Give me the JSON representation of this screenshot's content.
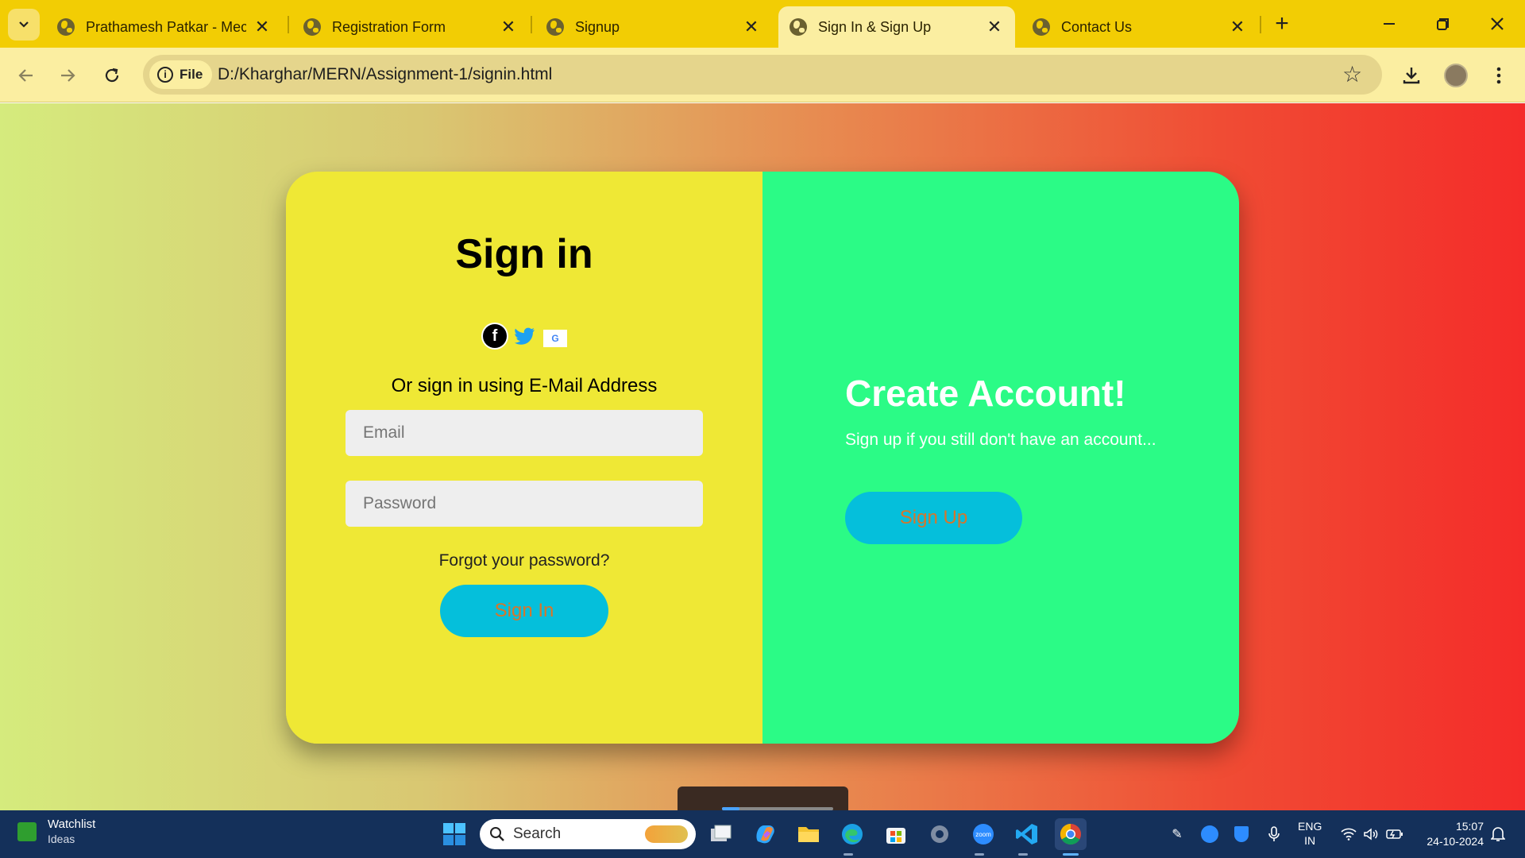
{
  "browser": {
    "tabs": [
      {
        "title": "Prathamesh Patkar - Mecha",
        "active": false
      },
      {
        "title": "Registration Form",
        "active": false
      },
      {
        "title": "Signup",
        "active": false
      },
      {
        "title": "Sign In & Sign Up",
        "active": true
      },
      {
        "title": "Contact Us",
        "active": false
      }
    ],
    "close_glyph": "✕",
    "new_tab_glyph": "+",
    "file_chip": "File",
    "url": "D:/Kharghar/MERN/Assignment-1/signin.html"
  },
  "signin": {
    "title": "Sign in",
    "socials": [
      "facebook-icon",
      "twitter-icon",
      "google-icon"
    ],
    "or_text": "Or sign in using E-Mail Address",
    "email_placeholder": "Email",
    "password_placeholder": "Password",
    "forgot": "Forgot your password?",
    "button": "Sign In"
  },
  "signup": {
    "title": "Create Account!",
    "subtitle": "Sign up if you still don't have an account...",
    "button": "Sign Up"
  },
  "colors": {
    "left_panel": "#efe835",
    "right_panel": "#2bfb86",
    "button": "#05bfdb",
    "button_text": "#d8752a"
  },
  "taskbar": {
    "widget_title": "Watchlist",
    "widget_sub": "Ideas",
    "search_label": "Search",
    "lang_line1": "ENG",
    "lang_line2": "IN",
    "time": "15:07",
    "date": "24-10-2024"
  }
}
